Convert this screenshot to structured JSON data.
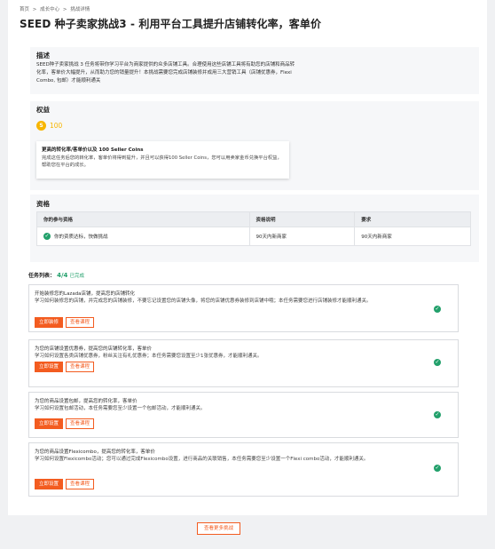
{
  "breadcrumb": [
    "首页",
    ">",
    "成长中心",
    ">",
    "挑战详情"
  ],
  "page_title": "SEED 种子卖家挑战3 - 利用平台工具提升店铺转化率，客单价",
  "description": {
    "heading": "描述",
    "text": "SEED种子卖家挑战 3 任务将带你学习平台为商家提供的众多店铺工具。合理使用这些店铺工具将有助您的店铺和商品转化率，客单价大幅提升，从而助力您的销量提升！本挑战需要您完成店铺装修并成用三大营销工具（店铺优惠券，Flexi Combo, 包邮）才能顺利通关"
  },
  "benefits": {
    "heading": "权益",
    "coin_symbol": "S",
    "coins": "100",
    "card_title": "更高的转化率/客单价以及 100 Seller Coins",
    "card_text": "完成这任务后您的转化率，客单价将得到提升，并且可以获得100 Seller Coins，您可以用卖家金币兑换平台权益，帮助您在平台的成长。"
  },
  "qualification": {
    "heading": "资格",
    "columns": [
      "你的参与资格",
      "资格说明",
      "要求"
    ],
    "row": [
      "你的资质达标，快做挑战",
      "90天内新商家",
      "90天内新商家"
    ]
  },
  "tasks": {
    "label": "任务列表：",
    "count": "4/4",
    "status": "已完成",
    "items": [
      {
        "title": "开始装修您的Lazada店铺，提高您的店铺转化",
        "desc": "学习如何装修您的店铺，并完成您的店铺装修，不要忘记设置您的店铺头像，将您的店铺优惠券装修到店铺中哦；本任务需要您进行店铺装修才能顺利通关。",
        "primary": "立即装修",
        "secondary": "查看课程"
      },
      {
        "title": "为您的店铺设置优惠券，提高您的店铺转化率，客单价",
        "desc": "学习如何设置各类店铺优惠券，粉丝关注有礼优惠券；本任务需要您设置至少1张优惠券，才能顺利通关。",
        "primary": "立即设置",
        "secondary": "查看课程"
      },
      {
        "title": "为您的商品设置包邮，提高您的转化率，客单价",
        "desc": "学习如何设置包邮活动，本任务需要您至少设置一个包邮活动，才能顺利通关。",
        "primary": "立即设置",
        "secondary": "查看课程"
      },
      {
        "title": "为您的商品设置Flexicombo，提高您的转化率，客单价",
        "desc": "学习如何设置Flexicombo活动；您可以通过完成Flexicombo设置，进行商品的关联销售，本任务需要您至少设置一个Flexi combo活动，才能顺利通关。",
        "primary": "立即设置",
        "secondary": "查看课程"
      }
    ]
  },
  "more_button": "查看更多挑战",
  "colors": {
    "accent": "#f35c20",
    "success": "#22a06b",
    "coin": "#f7b500"
  },
  "icons": {
    "done": "check-circle-icon",
    "coin": "seller-coin-icon"
  }
}
